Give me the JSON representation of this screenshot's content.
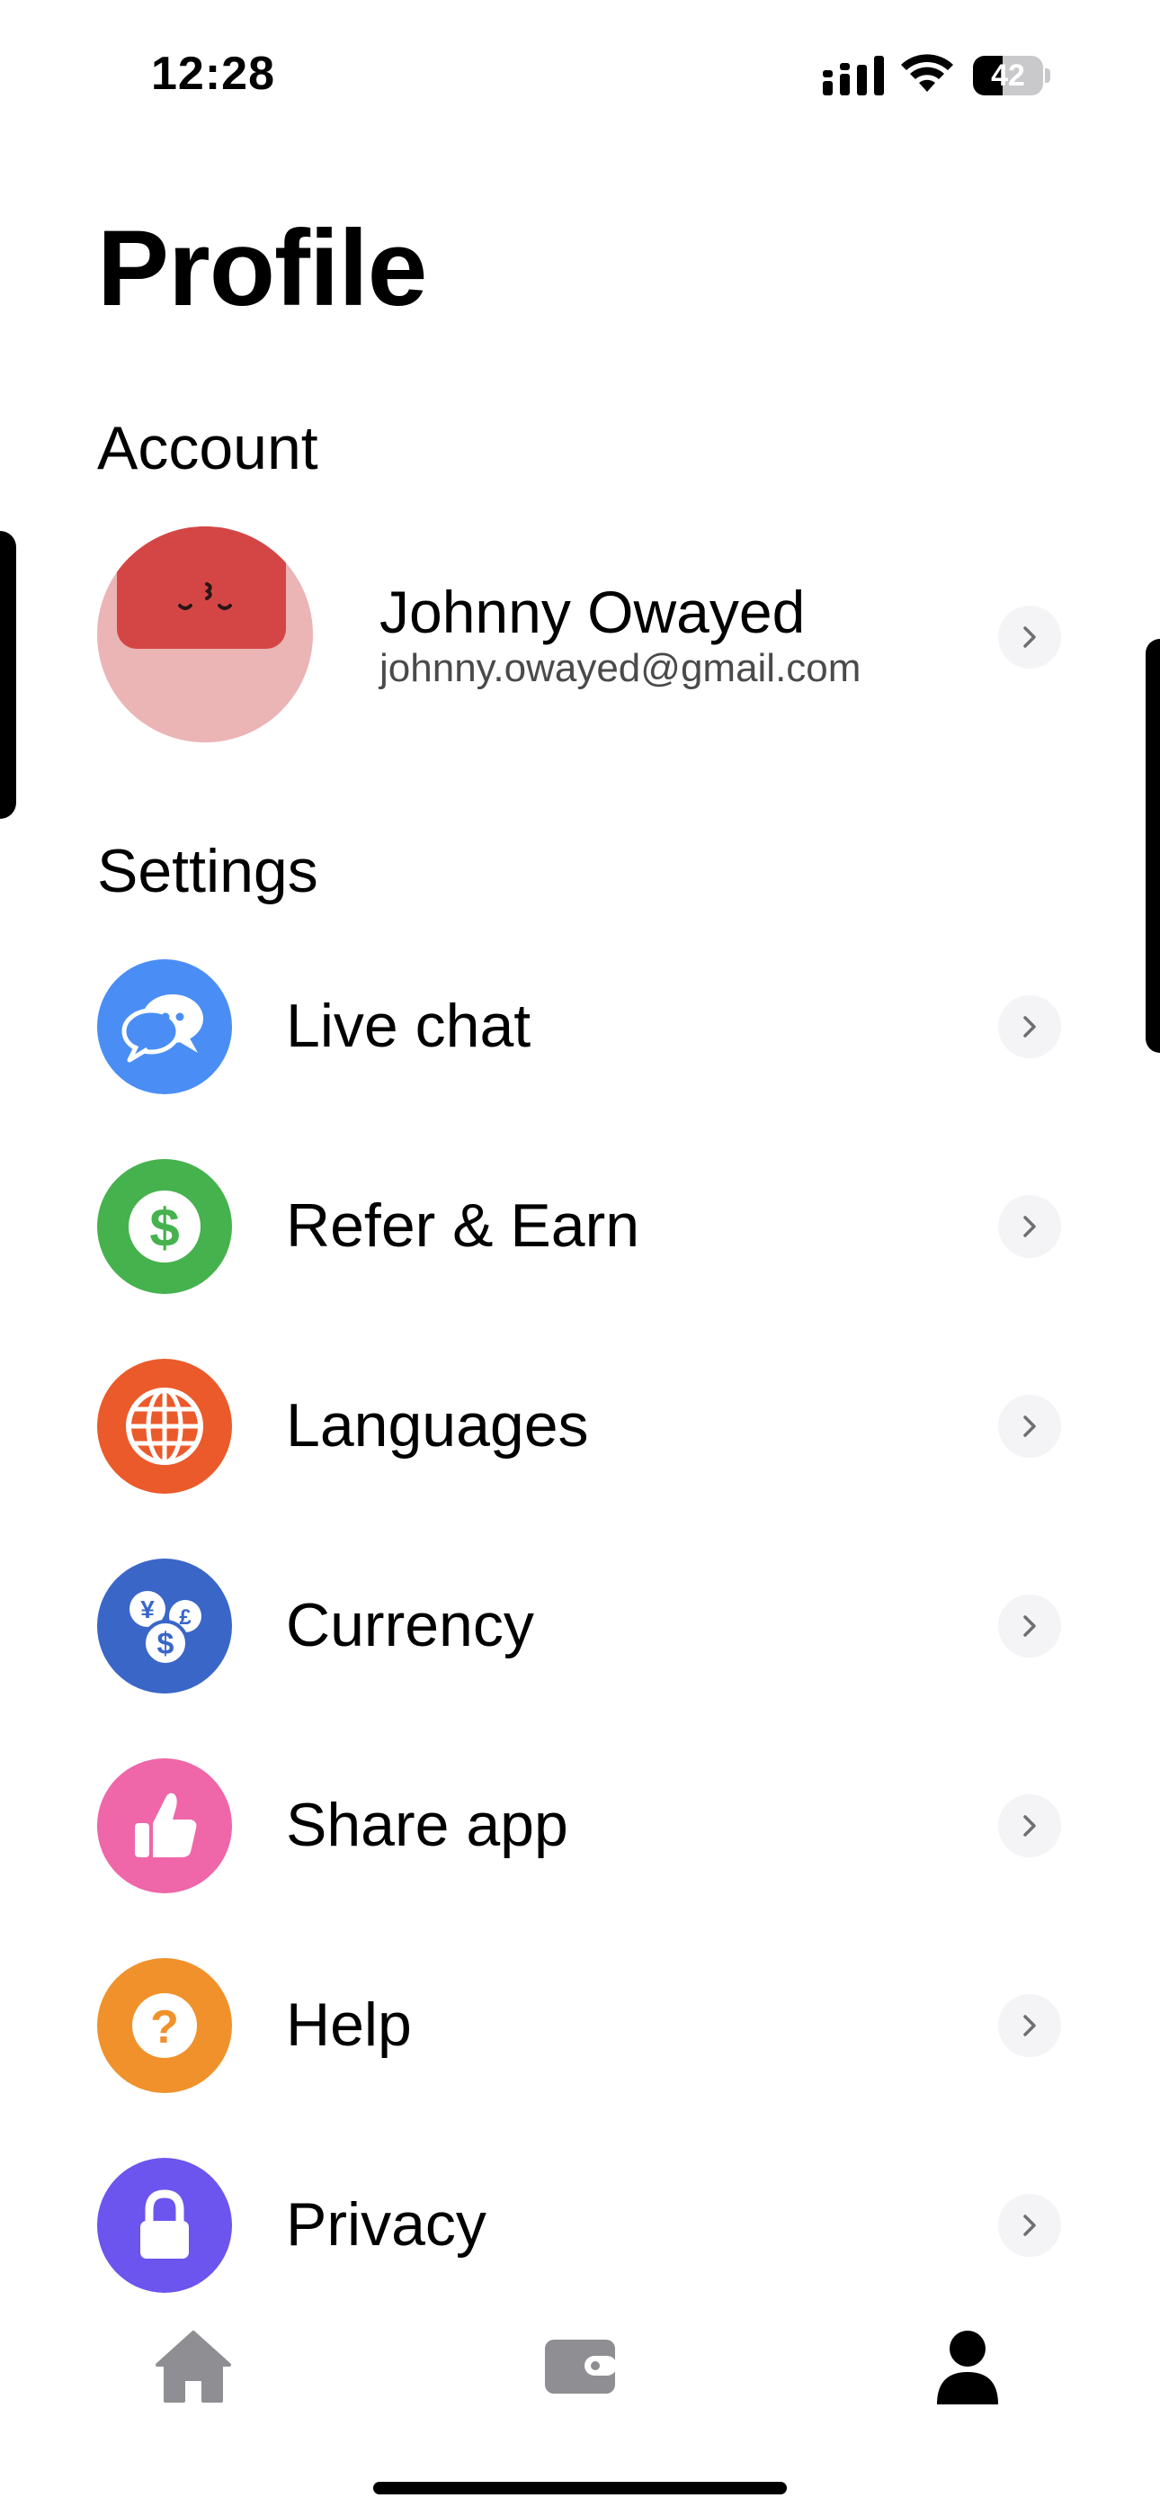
{
  "status_bar": {
    "time": "12:28",
    "battery_level": "42"
  },
  "page": {
    "title": "Profile"
  },
  "account": {
    "section_title": "Account",
    "name": "Johnny Owayed",
    "email": "johnny.owayed@gmail.com"
  },
  "settings": {
    "section_title": "Settings",
    "items": [
      {
        "label": "Live chat",
        "icon": "chat-bubbles-icon",
        "color": "#4a8ef5"
      },
      {
        "label": "Refer & Earn",
        "icon": "dollar-icon",
        "color": "#46b24e"
      },
      {
        "label": "Languages",
        "icon": "globe-icon",
        "color": "#eb5a2a"
      },
      {
        "label": "Currency",
        "icon": "currency-coins-icon",
        "color": "#3a66c8"
      },
      {
        "label": "Share app",
        "icon": "thumbs-up-icon",
        "color": "#ef66a9"
      },
      {
        "label": "Help",
        "icon": "question-icon",
        "color": "#f0912c"
      },
      {
        "label": "Privacy",
        "icon": "lock-icon",
        "color": "#6b55ee"
      }
    ]
  },
  "tab_bar": {
    "tabs": [
      {
        "name": "home",
        "icon": "home-icon",
        "active": false
      },
      {
        "name": "wallet",
        "icon": "wallet-icon",
        "active": false
      },
      {
        "name": "profile",
        "icon": "person-icon",
        "active": true
      }
    ],
    "active_color": "#000000",
    "inactive_color": "#8e8e93"
  }
}
